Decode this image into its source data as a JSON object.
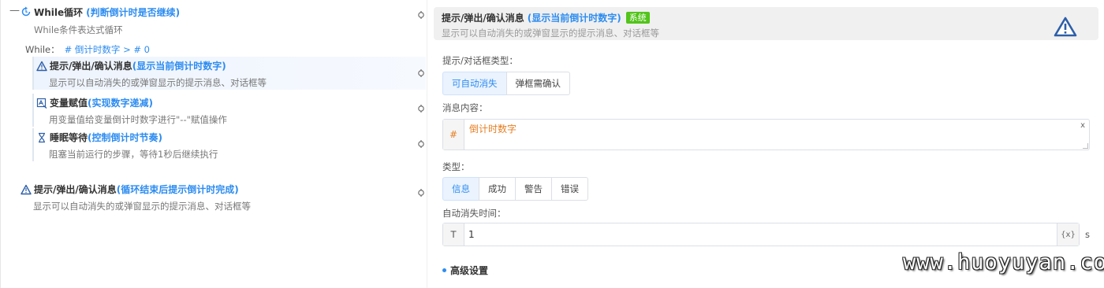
{
  "workflow": {
    "loop": {
      "collapse_symbol": "—",
      "icon": "loop-icon",
      "title": "While循环",
      "note": "(判断倒计时是否继续)",
      "desc": "While条件表达式循环",
      "cond_label": "While：",
      "cond_expr": "# 倒计时数字 > # 0"
    },
    "inner_steps": [
      {
        "icon": "warning-icon",
        "title": "提示/弹出/确认消息",
        "note": "(显示当前倒计时数字)",
        "desc": "显示可以自动消失的或弹窗显示的提示消息、对话框等",
        "active": true
      },
      {
        "icon": "variable-assign-icon",
        "title": "变量赋值",
        "note": "(实现数字递减)",
        "desc": "用变量值给变量倒计时数字进行\"--\"赋值操作",
        "active": false
      },
      {
        "icon": "hourglass-icon",
        "title": "睡眠等待",
        "note": "(控制倒计时节奏)",
        "desc": "阻塞当前运行的步骤，等待1秒后继续执行",
        "active": false
      }
    ],
    "final_step": {
      "icon": "warning-icon",
      "title": "提示/弹出/确认消息",
      "note": "(循环结束后提示倒计时完成)",
      "desc": "显示可以自动消失的或弹窗显示的提示消息、对话框等"
    }
  },
  "config": {
    "header": {
      "title": "提示/弹出/确认消息",
      "note": "(显示当前倒计时数字)",
      "tag": "系统",
      "subtitle": "显示可以自动消失的或弹窗显示的提示消息、对话框等",
      "icon": "warning-icon"
    },
    "dialog_type": {
      "label": "提示/对话框类型：",
      "options": [
        "可自动消失",
        "弹框需确认"
      ],
      "selected": "可自动消失"
    },
    "message": {
      "label": "消息内容：",
      "prefix": "#",
      "value": "倒计时数字",
      "clear": "x"
    },
    "type": {
      "label": "类型：",
      "options": [
        "信息",
        "成功",
        "警告",
        "错误"
      ],
      "selected": "信息"
    },
    "auto_close": {
      "label": "自动消失时间：",
      "prefix": "T",
      "value": "1",
      "var_button": "{x}",
      "unit": "s"
    },
    "advanced": {
      "label": "高级设置"
    }
  },
  "watermark": "www.huoyuyan.com",
  "colors": {
    "accent": "#2d8cf0",
    "tag_green": "#52c41a",
    "var_orange": "#e67e22",
    "active_row": "#eef4fd"
  }
}
